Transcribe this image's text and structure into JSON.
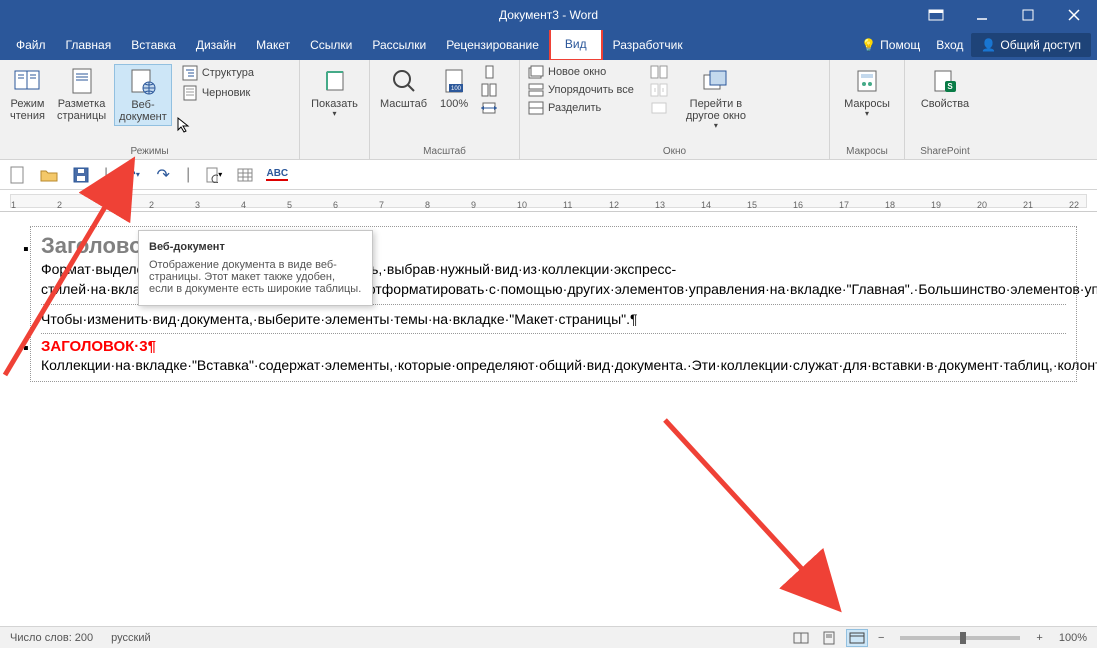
{
  "titlebar": {
    "title": "Документ3 - Word"
  },
  "menubar": {
    "file": "Файл",
    "home": "Главная",
    "insert": "Вставка",
    "design": "Дизайн",
    "layout": "Макет",
    "references": "Ссылки",
    "mailings": "Рассылки",
    "review": "Рецензирование",
    "view": "Вид",
    "developer": "Разработчик",
    "help": "Помощ",
    "signin": "Вход",
    "share": "Общий доступ"
  },
  "ribbon": {
    "groups": {
      "views": {
        "label": "Режимы",
        "read_mode": "Режим\nчтения",
        "print_layout": "Разметка\nстраницы",
        "web_layout": "Веб-\nдокумент",
        "outline": "Структура",
        "draft": "Черновик"
      },
      "show": {
        "button": "Показать"
      },
      "zoom": {
        "label": "Масштаб",
        "zoom": "Масштаб",
        "hundred": "100%"
      },
      "window": {
        "label": "Окно",
        "new_window": "Новое окно",
        "arrange_all": "Упорядочить все",
        "split": "Разделить",
        "switch": "Перейти в\nдругое окно"
      },
      "macros": {
        "label": "Макросы",
        "macros": "Макросы"
      },
      "sharepoint": {
        "label": "SharePoint",
        "properties": "Свойства"
      }
    }
  },
  "tooltip": {
    "title": "Веб-документ",
    "body": "Отображение документа в виде веб-страницы. Этот макет также удобен, если в документе есть широкие таблицы."
  },
  "doc": {
    "h2": "Заголовок",
    "p1": "Формат·выделенного·текста·можно·легко·изменить,·выбрав·нужный·вид·из·коллекции·экспресс-стилей·на·вкладке·\"Главная\".·Текст·можно·также·отформатировать·с·помощью·других·элементов·управления·на·вкладке·\"Главная\".·Большинство·элементов·управления·позволяют·использовать·вид·из·текущей·темы·и·формат,·указанный·непосредственно.·¶",
    "p2": "Чтобы·изменить·вид·документа,·выберите·элементы·темы·на·вкладке·\"Макет·страницы\".¶",
    "h3": "ЗАГОЛОВОК·3¶",
    "p3": "Коллекции·на·вкладке·\"Вставка\"·содержат·элементы,·которые·определяют·общий·вид·документа.·Эти·коллекции·служат·для·вставки·в·документ·таблиц,·колонтитулов,·списков,·титульных·страниц·и·других·стандартных·блоков.·При·создании·рисунков,·диаграмм·или·схем·они·согласовываются·с·видом·текущего·документа.¶"
  },
  "statusbar": {
    "wordcount": "Число слов: 200",
    "language": "русский",
    "zoom": "100%"
  },
  "ruler": {
    "numbers": [
      1,
      2,
      1,
      2,
      3,
      4,
      5,
      6,
      7,
      8,
      9,
      10,
      11,
      12,
      13,
      14,
      15,
      16,
      17,
      18,
      19,
      20,
      21,
      22
    ]
  }
}
